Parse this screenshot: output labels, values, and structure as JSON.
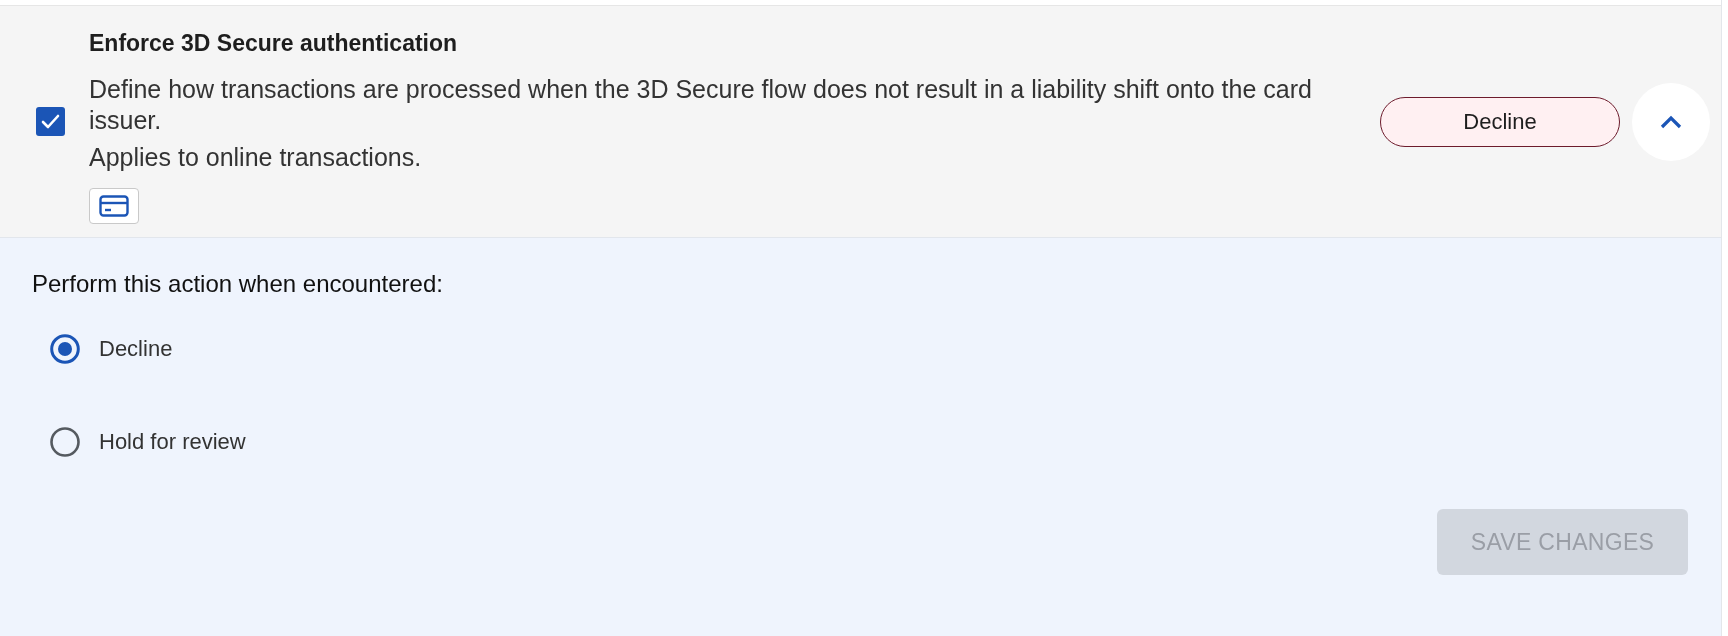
{
  "rule": {
    "title": "Enforce 3D Secure authentication",
    "checked": true,
    "description": "Define how transactions are processed when the 3D Secure flow does not result in a liability shift onto the card issuer.",
    "note": "Applies to online transactions.",
    "action_chip": {
      "label": "Decline"
    },
    "expanded": true
  },
  "action_panel": {
    "prompt": "Perform this action when encountered:",
    "options": [
      {
        "label": "Decline",
        "selected": true
      },
      {
        "label": "Hold for review",
        "selected": false
      }
    ],
    "save_button": {
      "label": "SAVE CHANGES",
      "disabled": true
    }
  }
}
